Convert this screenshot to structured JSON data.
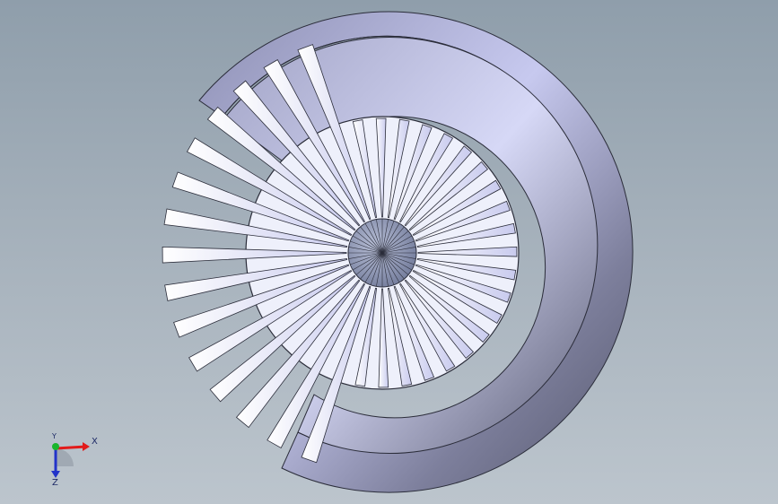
{
  "view": {
    "background_top": "#8f9eab",
    "background_bottom": "#bcc5cd"
  },
  "model": {
    "type": "radial-blower-impeller",
    "housing_color": "#b9bce6",
    "blade_color": "#e6e8fb",
    "hub_color": "#8d96b6",
    "blade_count": 36
  },
  "triad": {
    "x_label": "X",
    "y_label": "Y",
    "z_label": "Z",
    "x_color": "#e21b1b",
    "y_color": "#19b52b",
    "z_color": "#2233c9"
  }
}
